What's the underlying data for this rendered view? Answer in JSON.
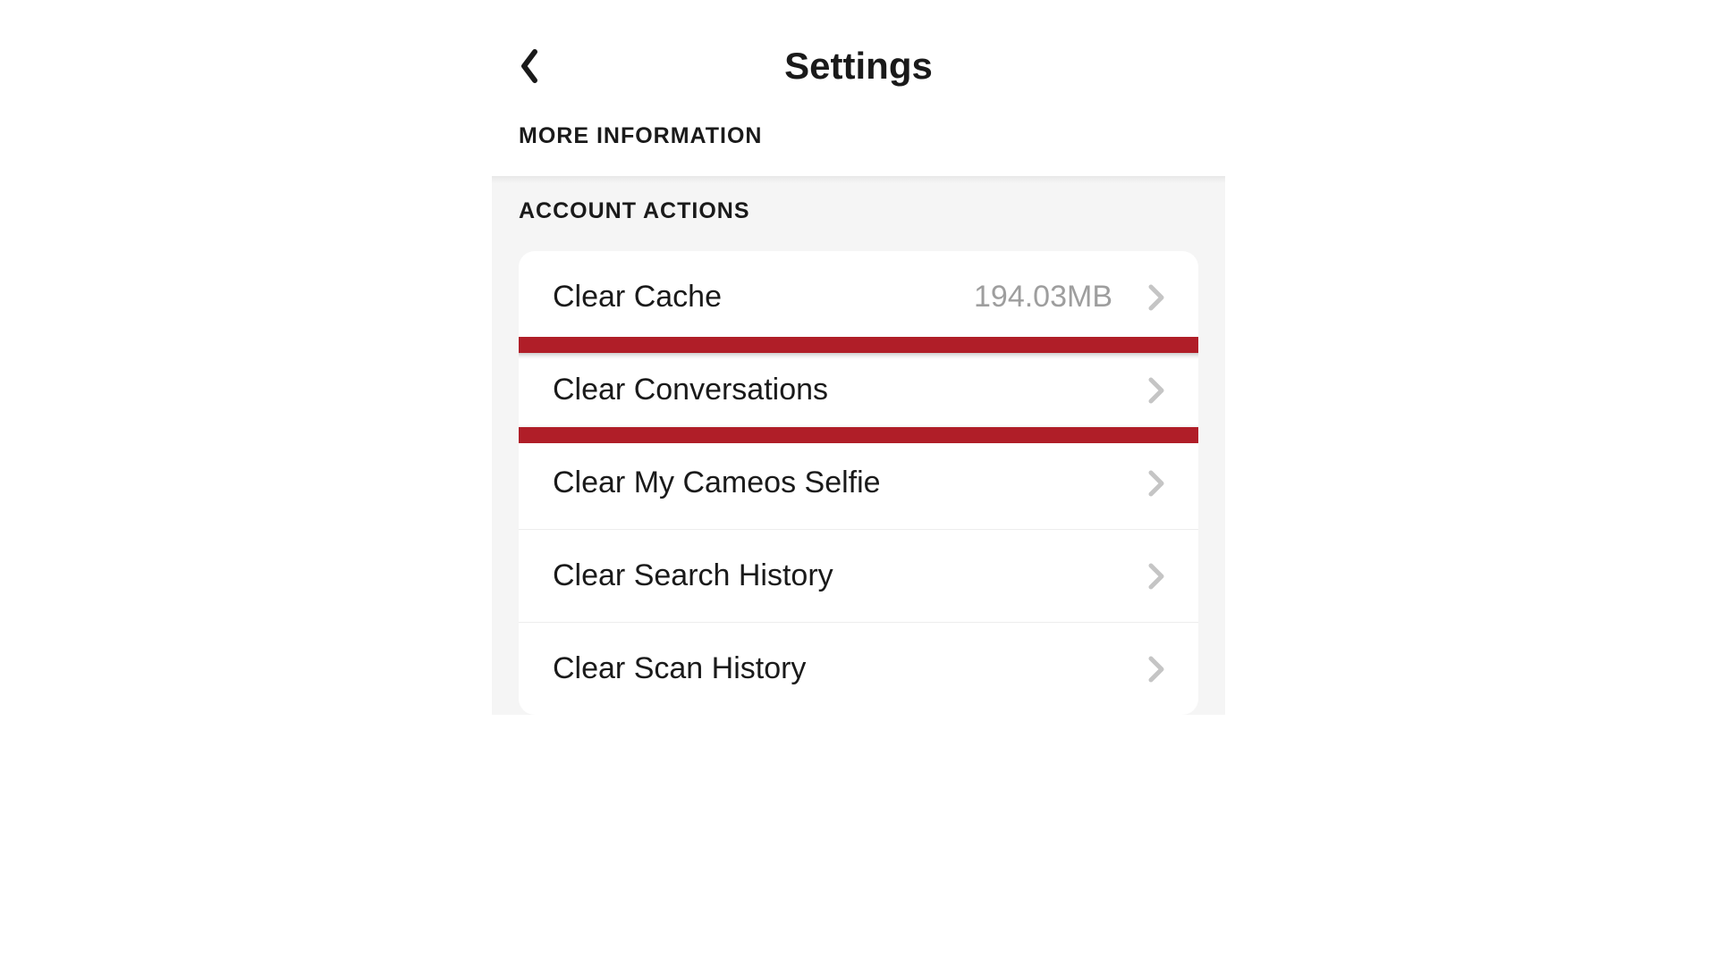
{
  "header": {
    "title": "Settings"
  },
  "sections": {
    "more_info_label": "MORE INFORMATION",
    "account_actions_label": "ACCOUNT ACTIONS"
  },
  "rows": {
    "clear_cache": {
      "label": "Clear Cache",
      "value": "194.03MB"
    },
    "clear_conversations": {
      "label": "Clear Conversations"
    },
    "clear_cameos": {
      "label": "Clear My Cameos Selfie"
    },
    "clear_search": {
      "label": "Clear Search History"
    },
    "clear_scan": {
      "label": "Clear Scan History"
    }
  }
}
